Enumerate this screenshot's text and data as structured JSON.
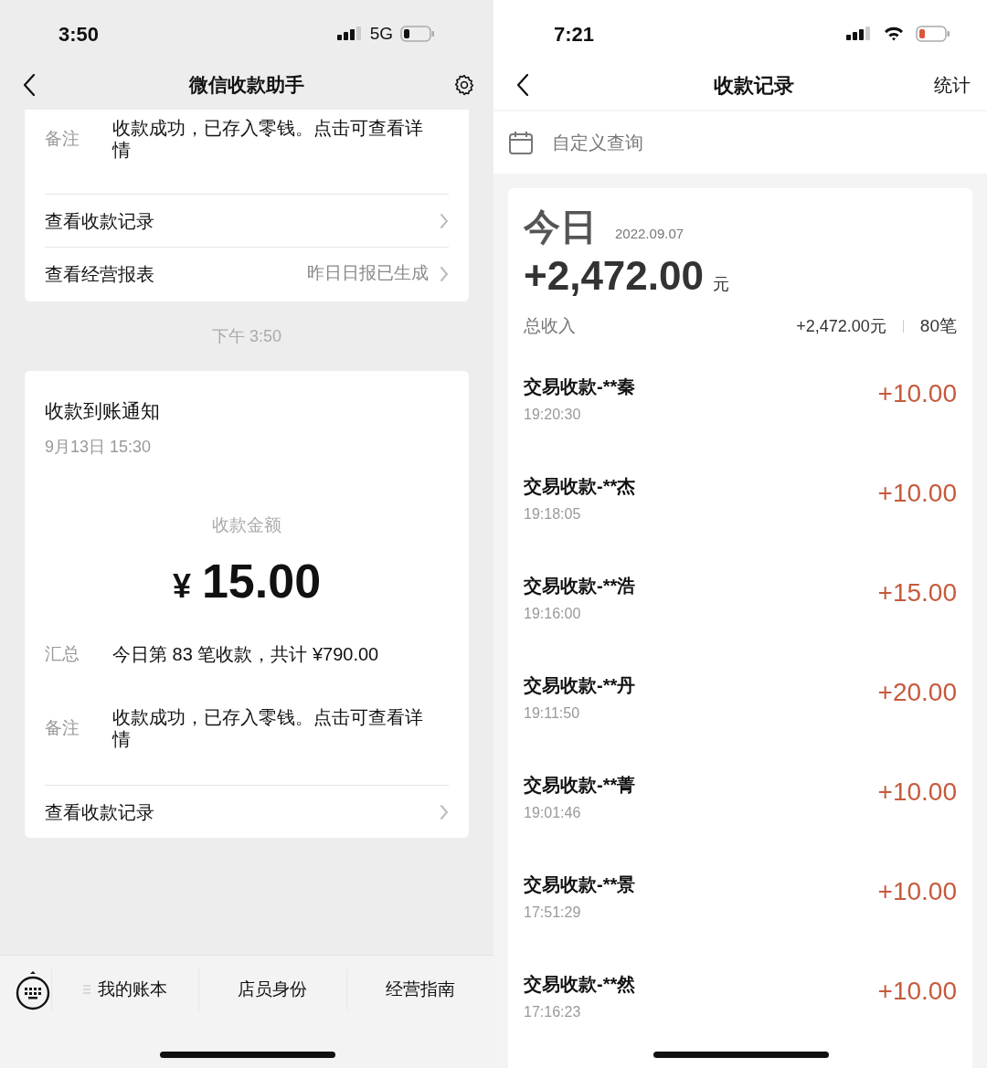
{
  "left": {
    "status_bar": {
      "time": "3:50",
      "network": "5G"
    },
    "nav": {
      "title": "微信收款助手"
    },
    "partial_card": {
      "note_label": "备注",
      "note_text": "收款成功，已存入零钱。点击可查看详情",
      "rows": [
        {
          "label": "查看收款记录"
        },
        {
          "label": "查看经营报表",
          "value": "昨日日报已生成"
        }
      ]
    },
    "timestamp": "下午 3:50",
    "notice_card": {
      "title": "收款到账通知",
      "datetime": "9月13日 15:30",
      "amount_label": "收款金额",
      "currency": "¥",
      "amount": "15.00",
      "summary_label": "汇总",
      "summary_text": "今日第 83 笔收款，共计 ¥790.00",
      "note_label": "备注",
      "note_text": "收款成功，已存入零钱。点击可查看详情",
      "rows": [
        {
          "label": "查看收款记录"
        }
      ]
    },
    "bottom_menu": [
      {
        "label": "我的账本",
        "has_menu_icon": true
      },
      {
        "label": "店员身份",
        "has_menu_icon": false
      },
      {
        "label": "经营指南",
        "has_menu_icon": false
      }
    ]
  },
  "right": {
    "status_bar": {
      "time": "7:21"
    },
    "nav": {
      "title": "收款记录",
      "action": "统计"
    },
    "query": {
      "label": "自定义查询"
    },
    "summary": {
      "day": "今日",
      "date": "2022.09.07",
      "total": "+2,472.00",
      "unit": "元",
      "income_label": "总收入",
      "income_total": "+2,472.00元",
      "count": "80笔"
    },
    "transactions": [
      {
        "name": "交易收款-**秦",
        "time": "19:20:30",
        "amount": "+10.00"
      },
      {
        "name": "交易收款-**杰",
        "time": "19:18:05",
        "amount": "+10.00"
      },
      {
        "name": "交易收款-**浩",
        "time": "19:16:00",
        "amount": "+15.00"
      },
      {
        "name": "交易收款-**丹",
        "time": "19:11:50",
        "amount": "+20.00"
      },
      {
        "name": "交易收款-**菁",
        "time": "19:01:46",
        "amount": "+10.00"
      },
      {
        "name": "交易收款-**景",
        "time": "17:51:29",
        "amount": "+10.00"
      },
      {
        "name": "交易收款-**然",
        "time": "17:16:23",
        "amount": "+10.00"
      }
    ]
  }
}
